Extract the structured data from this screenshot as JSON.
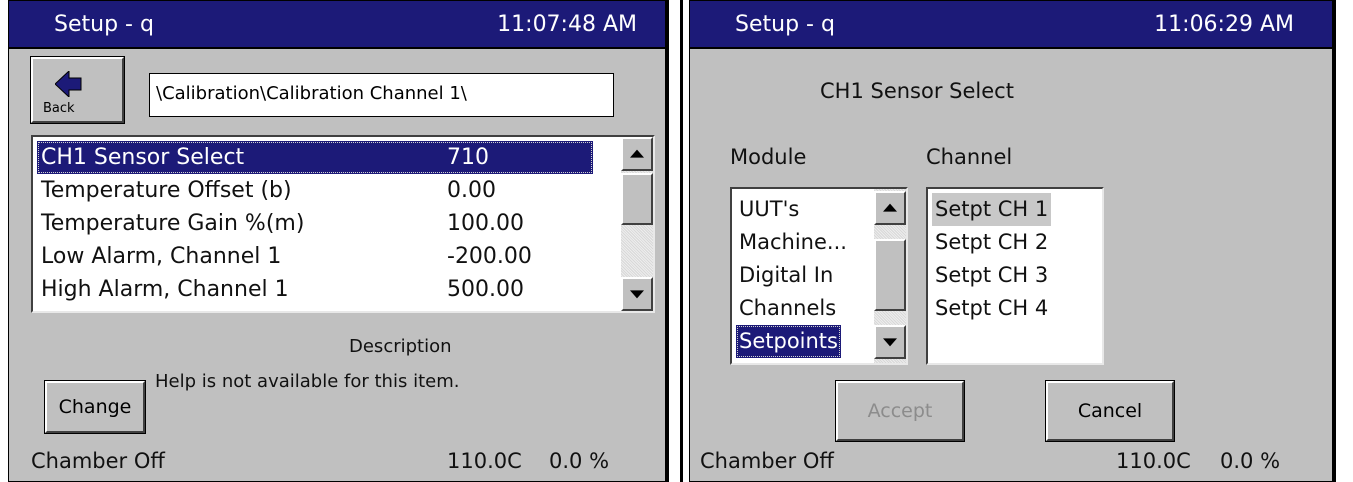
{
  "left": {
    "title": "Setup - q",
    "clock": "11:07:48 AM",
    "back_label": "Back",
    "path": "\\Calibration\\Calibration Channel 1\\",
    "rows": [
      {
        "name": "CH1 Sensor Select",
        "value": "710"
      },
      {
        "name": "Temperature Offset (b)",
        "value": "0.00"
      },
      {
        "name": "Temperature Gain %(m)",
        "value": "100.00"
      },
      {
        "name": "Low Alarm, Channel 1",
        "value": "-200.00"
      },
      {
        "name": "High Alarm, Channel 1",
        "value": "500.00"
      }
    ],
    "description_title": "Description",
    "description_text": "Help is not available for this item.",
    "change_label": "Change",
    "status": "Chamber Off",
    "temp": "110.0C",
    "percent": "0.0 %"
  },
  "right": {
    "title": "Setup - q",
    "clock": "11:06:29 AM",
    "heading": "CH1 Sensor Select",
    "module_label": "Module",
    "channel_label": "Channel",
    "modules": [
      "UUT's",
      "Machine...",
      "Digital In",
      "Channels",
      "Setpoints"
    ],
    "channels": [
      "Setpt CH 1",
      "Setpt CH 2",
      "Setpt CH 3",
      "Setpt CH 4"
    ],
    "accept_label": "Accept",
    "cancel_label": "Cancel",
    "status": "Chamber Off",
    "temp": "110.0C",
    "percent": "0.0 %"
  },
  "colors": {
    "titlebar": "#1c1a78",
    "panel": "#c0c0c0",
    "selection": "#1c1a78"
  }
}
